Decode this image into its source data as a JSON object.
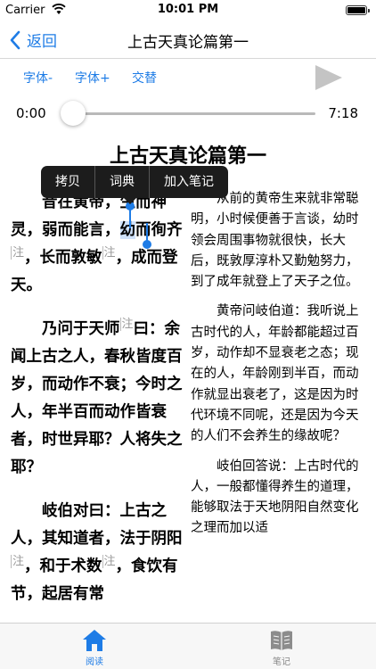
{
  "status": {
    "carrier": "Carrier",
    "time": "10:01 PM"
  },
  "nav": {
    "back_label": "返回",
    "title": "上古天真论篇第一"
  },
  "toolbar": {
    "font_decrease": "字体-",
    "font_increase": "字体+",
    "alternate": "交替"
  },
  "player": {
    "current_time": "0:00",
    "duration": "7:18",
    "progress": 0
  },
  "chapter_title": "上古天真论篇第一",
  "edit_menu": [
    "拷贝",
    "词典",
    "加入笔记"
  ],
  "note_marker": "注",
  "original": {
    "p1": {
      "a": "昔在黄帝，生而神灵，弱而能言，",
      "sel": "幼",
      "b": "而徇齐",
      "c": "，长而敦敏",
      "d": "，成而登天。"
    },
    "p2": {
      "a": "乃问于天师",
      "b": "曰：余闻上古之人，春秋皆度百岁，而动作不衰；今时之人，年半百而动作皆衰者，时世异耶？人将失之耶？"
    },
    "p3": {
      "a": "岐伯对曰：上古之人，其知道者，法于阴阳",
      "b": "，和于术数",
      "c": "，食饮有节，起居有常"
    }
  },
  "translation": {
    "p1": "从前的黄帝生来就非常聪明，小时候便善于言谈，幼时领会周围事物就很快，长大后，既敦厚淳朴又勤勉努力，到了成年就登上了天子之位。",
    "p2": "黄帝问岐伯道：我听说上古时代的人，年龄都能超过百岁，动作却不显衰老之态；现在的人，年龄刚到半百，而动作就显出衰老了，这是因为时代环境不同呢，还是因为今天的人们不会养生的缘故呢？",
    "p3": "岐伯回答说：上古时代的人，一般都懂得养生的道理，能够取法于天地阴阳自然变化之理而加以适"
  },
  "tabs": {
    "read": "阅读",
    "notes": "笔记"
  },
  "colors": {
    "accent": "#1e7ce6",
    "menu_bg": "#1c1c1c"
  }
}
